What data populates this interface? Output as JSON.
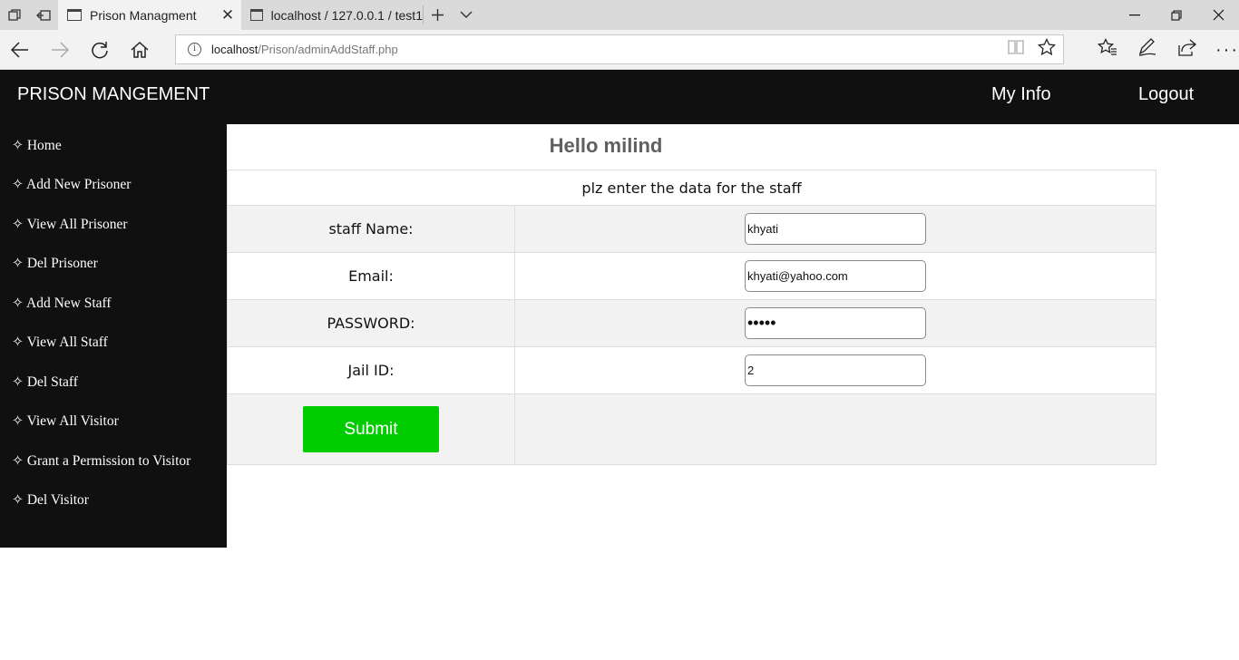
{
  "browser": {
    "tabs": [
      {
        "title": "Prison Managment",
        "active": true
      },
      {
        "title": "localhost / 127.0.0.1 / test1",
        "active": false
      }
    ],
    "address": {
      "host": "localhost",
      "path": "/Prison/adminAddStaff.php"
    }
  },
  "header": {
    "brand": "PRISON MANGEMENT",
    "links": [
      "My Info",
      "Logout"
    ]
  },
  "sidebar": {
    "items": [
      "✧ Home",
      "✧ Add New Prisoner",
      "✧ View All Prisoner",
      "✧ Del Prisoner",
      "✧ Add New Staff",
      "✧ View All Staff",
      "✧ Del Staff",
      "✧ View All Visitor",
      "✧ Grant a Permission to Visitor",
      "✧ Del Visitor"
    ]
  },
  "main": {
    "greeting": "Hello milind",
    "form": {
      "heading": "plz enter the data for the staff",
      "fields": [
        {
          "label": "staff Name:",
          "value": "khyati"
        },
        {
          "label": "Email:",
          "value": "khyati@yahoo.com"
        },
        {
          "label": "PASSWORD:",
          "value": "•••••"
        },
        {
          "label": "Jail ID:",
          "value": "2"
        }
      ],
      "submit_label": "Submit"
    }
  },
  "colors": {
    "header_bg": "#101010",
    "submit_bg": "#00cc00",
    "greeting_text": "#5f5f5f",
    "row_shade": "#f2f2f2"
  }
}
